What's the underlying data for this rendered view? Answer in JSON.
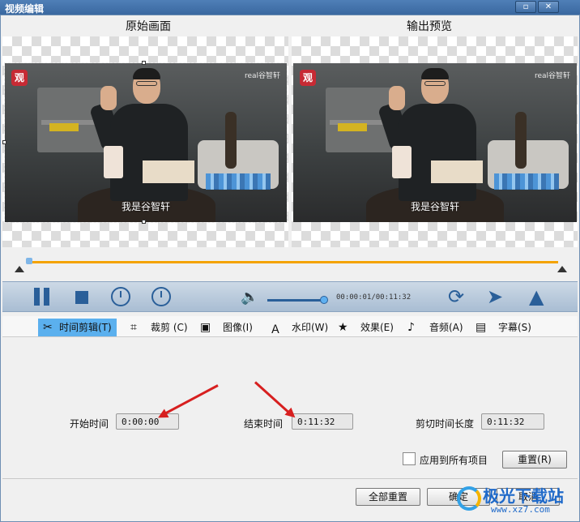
{
  "window": {
    "title": "视频编辑",
    "restore_icon": "restore-icon",
    "close_icon": "close-icon"
  },
  "preview": {
    "left_label": "原始画面",
    "right_label": "输出预览",
    "subtitle": "我是谷智轩",
    "watermark": "real谷智轩",
    "logo": "观"
  },
  "player": {
    "timecode": "00:00:01/00:11:32",
    "volume_level": 0.95
  },
  "tabs": [
    {
      "label": "时间剪辑(T)",
      "icon": "scissors-icon"
    },
    {
      "label": "裁剪 (C)",
      "icon": "crop-icon"
    },
    {
      "label": "图像(I)",
      "icon": "image-icon"
    },
    {
      "label": "水印(W)",
      "icon": "text-watermark-icon"
    },
    {
      "label": "效果(E)",
      "icon": "star-icon"
    },
    {
      "label": "音频(A)",
      "icon": "music-note-icon"
    },
    {
      "label": "字幕(S)",
      "icon": "subtitle-icon"
    }
  ],
  "trim": {
    "start_label": "开始时间",
    "start_value": "0:00:00",
    "end_label": "结束时间",
    "end_value": "0:11:32",
    "length_label": "剪切时间长度",
    "length_value": "0:11:32",
    "apply_all_label": "应用到所有项目",
    "reset_label": "重置(R)"
  },
  "footer": {
    "reset_all_label": "全部重置",
    "ok_label": "确定",
    "cancel_label": "取消",
    "brand_name": "极光下载站",
    "brand_url": "www.xz7.com"
  },
  "colors": {
    "accent": "#5bb0ee",
    "timeline": "#f4a300",
    "control_blue": "#2a5f99",
    "annotation_red": "#d71f1f"
  }
}
